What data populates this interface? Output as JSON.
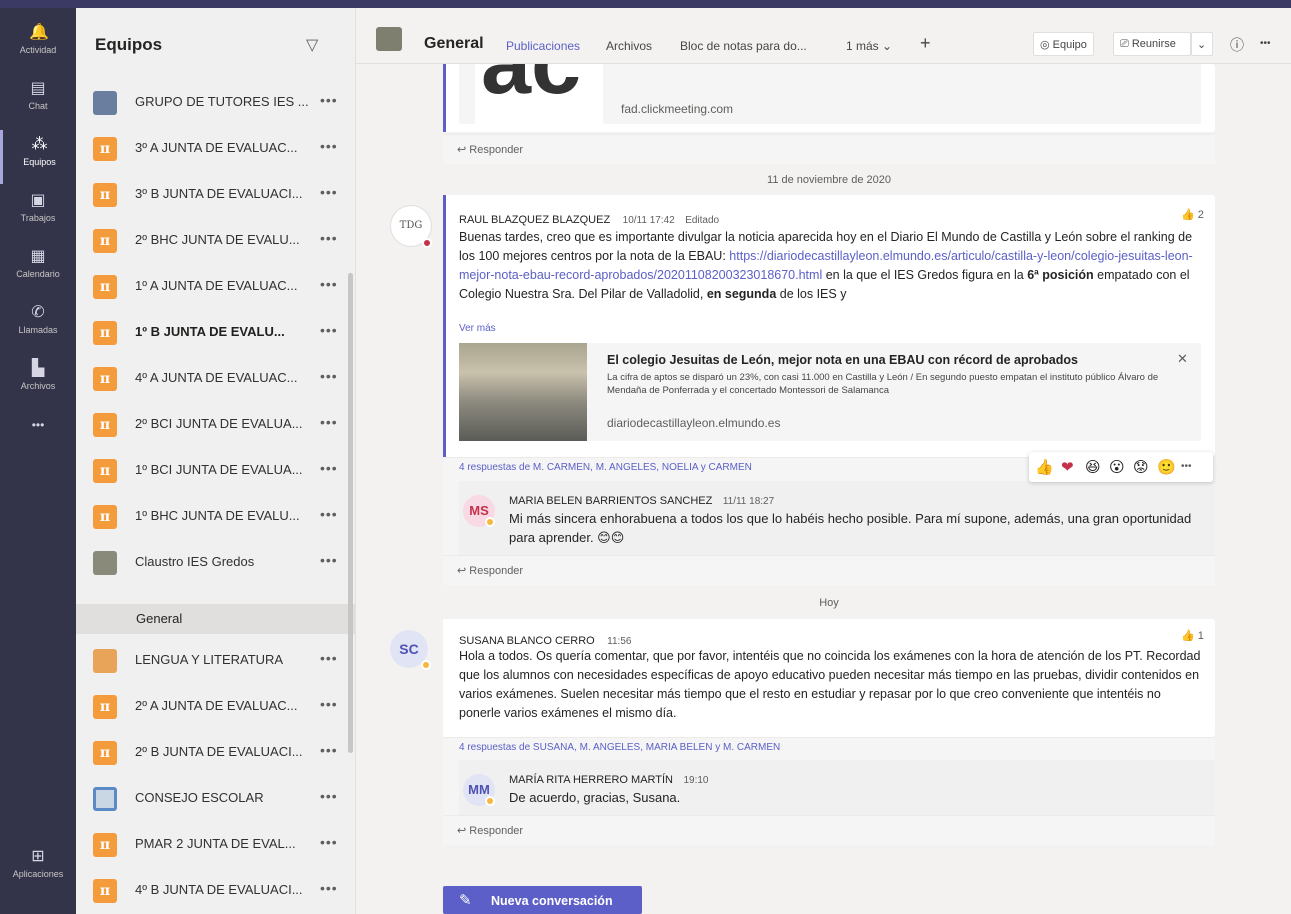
{
  "rail": {
    "items": [
      {
        "label": "Actividad",
        "icon": "bell-icon",
        "glyph": "🔔"
      },
      {
        "label": "Chat",
        "icon": "chat-icon",
        "glyph": "▤"
      },
      {
        "label": "Equipos",
        "icon": "teams-icon",
        "glyph": "⁂"
      },
      {
        "label": "Trabajos",
        "icon": "assignments-icon",
        "glyph": "▣"
      },
      {
        "label": "Calendario",
        "icon": "calendar-icon",
        "glyph": "▦"
      },
      {
        "label": "Llamadas",
        "icon": "phone-icon",
        "glyph": "✆"
      },
      {
        "label": "Archivos",
        "icon": "files-icon",
        "glyph": "▙"
      },
      {
        "label": "",
        "icon": "more-apps-icon",
        "glyph": "•••"
      }
    ],
    "apps_label": "Aplicaciones"
  },
  "sidebar": {
    "title": "Equipos",
    "teams": [
      {
        "label": "GRUPO DE TUTORES IES ...",
        "av": "img"
      },
      {
        "label": "3º A JUNTA DE EVALUAC...",
        "av": "pi"
      },
      {
        "label": "3º B JUNTA DE EVALUACI...",
        "av": "pi"
      },
      {
        "label": "2º BHC JUNTA DE EVALU...",
        "av": "pi"
      },
      {
        "label": "1º A JUNTA DE EVALUAC...",
        "av": "pi"
      },
      {
        "label": "1º B JUNTA DE EVALU...",
        "av": "pi",
        "bold": true
      },
      {
        "label": "4º A JUNTA DE EVALUAC...",
        "av": "pi"
      },
      {
        "label": "2º BCI JUNTA DE EVALUA...",
        "av": "pi"
      },
      {
        "label": "1º BCI JUNTA DE EVALUA...",
        "av": "pi"
      },
      {
        "label": "1º BHC JUNTA DE EVALU...",
        "av": "pi"
      },
      {
        "label": "Claustro IES Gredos",
        "av": "img2"
      },
      {
        "label": "LENGUA Y LITERATURA",
        "av": "img3"
      },
      {
        "label": "2º A JUNTA DE EVALUAC...",
        "av": "pi"
      },
      {
        "label": "2º B JUNTA DE EVALUACI...",
        "av": "pi"
      },
      {
        "label": "CONSEJO ESCOLAR",
        "av": "img4"
      },
      {
        "label": "PMAR 2 JUNTA DE EVAL...",
        "av": "pi"
      },
      {
        "label": "4º B JUNTA DE EVALUACI...",
        "av": "pi"
      }
    ],
    "channel": "General",
    "pi_glyph": "π",
    "more_glyph": "•••"
  },
  "header": {
    "channel": "General",
    "tabs": [
      "Publicaciones",
      "Archivos",
      "Bloc de notas para do...",
      "1 más ⌄"
    ],
    "team_btn": "◎ Equipo",
    "meet_btn": "⎚ Reunirse",
    "meet_caret": "⌄",
    "info_icon": "ⓘ",
    "more_icon": "•••",
    "plus": "+"
  },
  "feed": {
    "top_link": "fad.clickmeeting.com",
    "reply_label": "↩ Responder",
    "date1": "11 de noviembre de 2020",
    "post1": {
      "author": "RAUL BLAZQUEZ BLAZQUEZ",
      "time": "10/11 17:42",
      "edited": "Editado",
      "likes": "👍 2",
      "text_a": "Buenas tardes, creo que es importante divulgar la noticia aparecida hoy en el Diario El Mundo de Castilla y León sobre el ranking de los 100 mejores centros por la nota de la EBAU: ",
      "url": "https://diariodecastillayleon.elmundo.es/articulo/castilla-y-leon/colegio-jesuitas-leon-mejor-nota-ebau-record-aprobados/20201108200323018670.html",
      "text_b": " en la que el IES Gredos figura en la ",
      "bold1": "6ª posición",
      "text_c": " empatado con el Colegio Nuestra Sra. Del Pilar de Valladolid, ",
      "bold2": "en segunda",
      "text_d": " de los IES y",
      "see_more": "Ver más",
      "preview_title": "El colegio Jesuitas de León, mejor nota en una EBAU con récord de aprobados",
      "preview_desc": "La cifra de aptos se disparó un 23%, con casi 11.000 en Castilla y León / En segundo puesto empatan el instituto público Álvaro de Mendaña de Ponferrada y el concertado Montessori de Salamanca",
      "preview_domain": "diariodecastillayleon.elmundo.es",
      "close": "✕",
      "replies": "4 respuestas de M. CARMEN, M. ANGELES, NOELIA y CARMEN",
      "reply_author": "MARIA BELEN BARRIENTOS SANCHEZ",
      "reply_time": "11/11 18:27",
      "reply_initials": "MS",
      "reply_text": "Mi más sincera enhorabuena a todos los que lo habéis hecho posible. Para mí supone, además, una gran oportunidad para aprender. 😊😊",
      "avatar_text": "TDG"
    },
    "reactions": [
      "👍",
      "❤",
      "😆",
      "😮",
      "😟",
      "🙂",
      "•••"
    ],
    "date2": "Hoy",
    "post2": {
      "initials": "SC",
      "author": "SUSANA BLANCO CERRO",
      "time": "11:56",
      "likes": "👍 1",
      "text": "Hola a todos. Os quería comentar, que por favor, intentéis que no coincida los exámenes con la hora de atención de los PT. Recordad que los alumnos con necesidades específicas de apoyo educativo pueden necesitar más tiempo en las pruebas, dividir contenidos en varios exámenes. Suelen necesitar más tiempo que el resto en estudiar y repasar por lo que creo conveniente que intentéis no ponerle varios exámenes el mismo día.",
      "replies": "4 respuestas de SUSANA, M. ANGELES, MARIA BELEN y M. CARMEN",
      "reply_initials": "MM",
      "reply_author": "MARÍA RITA HERRERO MARTÍN",
      "reply_time": "19:10",
      "reply_text": "De acuerdo, gracias, Susana."
    },
    "new_conversation": "Nueva conversación",
    "new_conversation_icon": "✎"
  },
  "colors": {
    "accent": "#5b5fc7",
    "rail": "#33344a",
    "team_avatar": "#f49b3c",
    "presence_away": "#f8b73b",
    "presence_busy": "#c4314b"
  }
}
